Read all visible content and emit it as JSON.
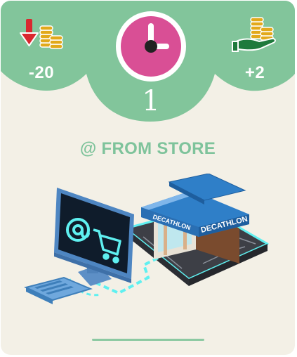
{
  "card": {
    "colors": {
      "background": "#f3f0e6",
      "header_green": "#82c59b",
      "accent_text": "#7ec39b",
      "clock_pink": "#d94f95"
    }
  },
  "stats": {
    "left": {
      "icon": "coins-down-arrow-icon",
      "value": "-20"
    },
    "right": {
      "icon": "coins-hand-icon",
      "value": "+2"
    }
  },
  "turn": {
    "icon": "clock-icon",
    "number": "1"
  },
  "title": "@ FROM STORE",
  "illustration": {
    "icons": [
      "computer-monitor-icon",
      "at-sign-icon",
      "shopping-cart-icon",
      "keyboard-icon",
      "store-building-icon"
    ],
    "store_sign": "DECATHLON"
  }
}
